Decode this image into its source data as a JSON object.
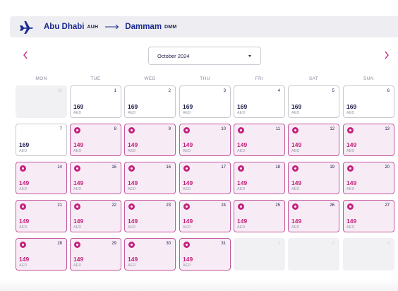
{
  "route": {
    "origin_city": "Abu Dhabi",
    "origin_code": "AUH",
    "destination_city": "Dammam",
    "destination_code": "DMM",
    "icon": "airplane-icon",
    "arrow_icon": "arrow-right-icon"
  },
  "navigation": {
    "prev_icon": "chevron-left-icon",
    "next_icon": "chevron-right-icon"
  },
  "month_select": {
    "selected": "October 2024"
  },
  "weekdays": [
    "MON",
    "TUE",
    "WED",
    "THU",
    "FRI",
    "SAT",
    "SUN"
  ],
  "colors": {
    "brand_navy": "#1b2a8f",
    "promo_magenta": "#c4217d",
    "promo_background": "#f7ecf5",
    "nav_arrow": "#c4217d"
  },
  "calendar": {
    "weeks": [
      [
        {
          "day": "30",
          "price": "",
          "currency": "",
          "type": "empty"
        },
        {
          "day": "1",
          "price": "169",
          "currency": "AED",
          "type": "regular"
        },
        {
          "day": "2",
          "price": "169",
          "currency": "AED",
          "type": "regular"
        },
        {
          "day": "3",
          "price": "169",
          "currency": "AED",
          "type": "regular"
        },
        {
          "day": "4",
          "price": "169",
          "currency": "AED",
          "type": "regular"
        },
        {
          "day": "5",
          "price": "169",
          "currency": "AED",
          "type": "regular"
        },
        {
          "day": "6",
          "price": "169",
          "currency": "AED",
          "type": "regular"
        }
      ],
      [
        {
          "day": "7",
          "price": "169",
          "currency": "AED",
          "type": "regular"
        },
        {
          "day": "8",
          "price": "149",
          "currency": "AED",
          "type": "promo"
        },
        {
          "day": "9",
          "price": "149",
          "currency": "AED",
          "type": "promo"
        },
        {
          "day": "10",
          "price": "149",
          "currency": "AED",
          "type": "promo"
        },
        {
          "day": "11",
          "price": "149",
          "currency": "AED",
          "type": "promo"
        },
        {
          "day": "12",
          "price": "149",
          "currency": "AED",
          "type": "promo"
        },
        {
          "day": "13",
          "price": "149",
          "currency": "AED",
          "type": "promo"
        }
      ],
      [
        {
          "day": "14",
          "price": "149",
          "currency": "AED",
          "type": "promo"
        },
        {
          "day": "15",
          "price": "149",
          "currency": "AED",
          "type": "promo"
        },
        {
          "day": "16",
          "price": "149",
          "currency": "AED",
          "type": "promo"
        },
        {
          "day": "17",
          "price": "149",
          "currency": "AED",
          "type": "promo"
        },
        {
          "day": "18",
          "price": "149",
          "currency": "AED",
          "type": "promo"
        },
        {
          "day": "19",
          "price": "149",
          "currency": "AED",
          "type": "promo"
        },
        {
          "day": "20",
          "price": "149",
          "currency": "AED",
          "type": "promo"
        }
      ],
      [
        {
          "day": "21",
          "price": "149",
          "currency": "AED",
          "type": "promo"
        },
        {
          "day": "22",
          "price": "149",
          "currency": "AED",
          "type": "promo"
        },
        {
          "day": "23",
          "price": "149",
          "currency": "AED",
          "type": "promo"
        },
        {
          "day": "24",
          "price": "149",
          "currency": "AED",
          "type": "promo"
        },
        {
          "day": "25",
          "price": "149",
          "currency": "AED",
          "type": "promo"
        },
        {
          "day": "26",
          "price": "149",
          "currency": "AED",
          "type": "promo"
        },
        {
          "day": "27",
          "price": "149",
          "currency": "AED",
          "type": "promo"
        }
      ],
      [
        {
          "day": "28",
          "price": "149",
          "currency": "AED",
          "type": "promo"
        },
        {
          "day": "29",
          "price": "149",
          "currency": "AED",
          "type": "promo"
        },
        {
          "day": "30",
          "price": "149",
          "currency": "AED",
          "type": "promo"
        },
        {
          "day": "31",
          "price": "149",
          "currency": "AED",
          "type": "promo"
        },
        {
          "day": "1",
          "price": "",
          "currency": "",
          "type": "empty"
        },
        {
          "day": "2",
          "price": "",
          "currency": "",
          "type": "empty"
        },
        {
          "day": "3",
          "price": "",
          "currency": "",
          "type": "empty"
        }
      ]
    ]
  }
}
